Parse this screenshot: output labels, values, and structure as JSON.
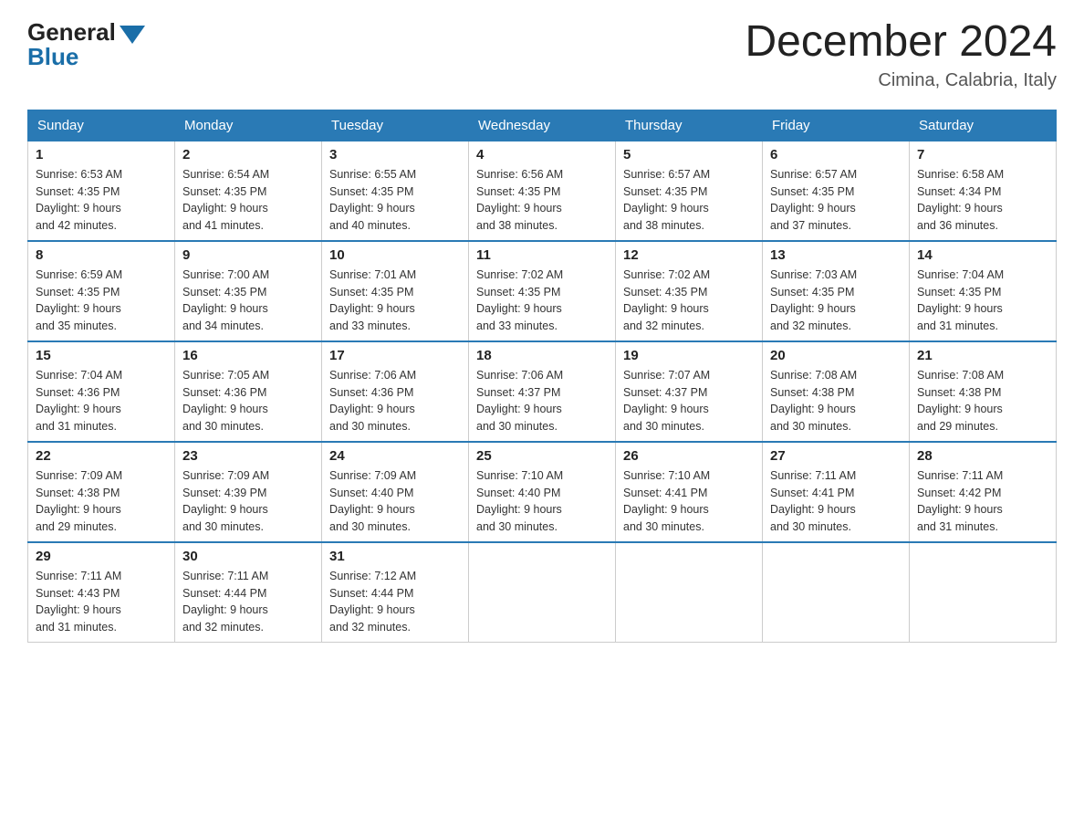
{
  "header": {
    "logo_general": "General",
    "logo_blue": "Blue",
    "month_title": "December 2024",
    "location": "Cimina, Calabria, Italy"
  },
  "days_of_week": [
    "Sunday",
    "Monday",
    "Tuesday",
    "Wednesday",
    "Thursday",
    "Friday",
    "Saturday"
  ],
  "weeks": [
    [
      {
        "day": "1",
        "sunrise": "6:53 AM",
        "sunset": "4:35 PM",
        "daylight": "9 hours and 42 minutes."
      },
      {
        "day": "2",
        "sunrise": "6:54 AM",
        "sunset": "4:35 PM",
        "daylight": "9 hours and 41 minutes."
      },
      {
        "day": "3",
        "sunrise": "6:55 AM",
        "sunset": "4:35 PM",
        "daylight": "9 hours and 40 minutes."
      },
      {
        "day": "4",
        "sunrise": "6:56 AM",
        "sunset": "4:35 PM",
        "daylight": "9 hours and 38 minutes."
      },
      {
        "day": "5",
        "sunrise": "6:57 AM",
        "sunset": "4:35 PM",
        "daylight": "9 hours and 38 minutes."
      },
      {
        "day": "6",
        "sunrise": "6:57 AM",
        "sunset": "4:35 PM",
        "daylight": "9 hours and 37 minutes."
      },
      {
        "day": "7",
        "sunrise": "6:58 AM",
        "sunset": "4:34 PM",
        "daylight": "9 hours and 36 minutes."
      }
    ],
    [
      {
        "day": "8",
        "sunrise": "6:59 AM",
        "sunset": "4:35 PM",
        "daylight": "9 hours and 35 minutes."
      },
      {
        "day": "9",
        "sunrise": "7:00 AM",
        "sunset": "4:35 PM",
        "daylight": "9 hours and 34 minutes."
      },
      {
        "day": "10",
        "sunrise": "7:01 AM",
        "sunset": "4:35 PM",
        "daylight": "9 hours and 33 minutes."
      },
      {
        "day": "11",
        "sunrise": "7:02 AM",
        "sunset": "4:35 PM",
        "daylight": "9 hours and 33 minutes."
      },
      {
        "day": "12",
        "sunrise": "7:02 AM",
        "sunset": "4:35 PM",
        "daylight": "9 hours and 32 minutes."
      },
      {
        "day": "13",
        "sunrise": "7:03 AM",
        "sunset": "4:35 PM",
        "daylight": "9 hours and 32 minutes."
      },
      {
        "day": "14",
        "sunrise": "7:04 AM",
        "sunset": "4:35 PM",
        "daylight": "9 hours and 31 minutes."
      }
    ],
    [
      {
        "day": "15",
        "sunrise": "7:04 AM",
        "sunset": "4:36 PM",
        "daylight": "9 hours and 31 minutes."
      },
      {
        "day": "16",
        "sunrise": "7:05 AM",
        "sunset": "4:36 PM",
        "daylight": "9 hours and 30 minutes."
      },
      {
        "day": "17",
        "sunrise": "7:06 AM",
        "sunset": "4:36 PM",
        "daylight": "9 hours and 30 minutes."
      },
      {
        "day": "18",
        "sunrise": "7:06 AM",
        "sunset": "4:37 PM",
        "daylight": "9 hours and 30 minutes."
      },
      {
        "day": "19",
        "sunrise": "7:07 AM",
        "sunset": "4:37 PM",
        "daylight": "9 hours and 30 minutes."
      },
      {
        "day": "20",
        "sunrise": "7:08 AM",
        "sunset": "4:38 PM",
        "daylight": "9 hours and 30 minutes."
      },
      {
        "day": "21",
        "sunrise": "7:08 AM",
        "sunset": "4:38 PM",
        "daylight": "9 hours and 29 minutes."
      }
    ],
    [
      {
        "day": "22",
        "sunrise": "7:09 AM",
        "sunset": "4:38 PM",
        "daylight": "9 hours and 29 minutes."
      },
      {
        "day": "23",
        "sunrise": "7:09 AM",
        "sunset": "4:39 PM",
        "daylight": "9 hours and 30 minutes."
      },
      {
        "day": "24",
        "sunrise": "7:09 AM",
        "sunset": "4:40 PM",
        "daylight": "9 hours and 30 minutes."
      },
      {
        "day": "25",
        "sunrise": "7:10 AM",
        "sunset": "4:40 PM",
        "daylight": "9 hours and 30 minutes."
      },
      {
        "day": "26",
        "sunrise": "7:10 AM",
        "sunset": "4:41 PM",
        "daylight": "9 hours and 30 minutes."
      },
      {
        "day": "27",
        "sunrise": "7:11 AM",
        "sunset": "4:41 PM",
        "daylight": "9 hours and 30 minutes."
      },
      {
        "day": "28",
        "sunrise": "7:11 AM",
        "sunset": "4:42 PM",
        "daylight": "9 hours and 31 minutes."
      }
    ],
    [
      {
        "day": "29",
        "sunrise": "7:11 AM",
        "sunset": "4:43 PM",
        "daylight": "9 hours and 31 minutes."
      },
      {
        "day": "30",
        "sunrise": "7:11 AM",
        "sunset": "4:44 PM",
        "daylight": "9 hours and 32 minutes."
      },
      {
        "day": "31",
        "sunrise": "7:12 AM",
        "sunset": "4:44 PM",
        "daylight": "9 hours and 32 minutes."
      },
      null,
      null,
      null,
      null
    ]
  ],
  "labels": {
    "sunrise": "Sunrise:",
    "sunset": "Sunset:",
    "daylight": "Daylight:"
  }
}
